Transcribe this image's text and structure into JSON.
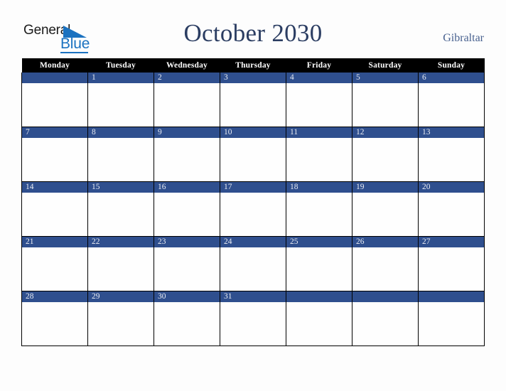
{
  "brand": {
    "name_part1": "General",
    "name_part2": "Blue",
    "accent_color": "#1b72c0",
    "triangle_icon": "triangle-icon"
  },
  "header": {
    "title": "October 2030",
    "country": "Gibraltar",
    "title_color": "#2b3d62",
    "country_color": "#48618f"
  },
  "calendar": {
    "month": "October",
    "year": "2030",
    "header_background": "#000000",
    "day_bar_color": "#2f4f8e",
    "weekday_headers": [
      "Monday",
      "Tuesday",
      "Wednesday",
      "Thursday",
      "Friday",
      "Saturday",
      "Sunday"
    ],
    "weeks": [
      [
        "",
        "1",
        "2",
        "3",
        "4",
        "5",
        "6"
      ],
      [
        "7",
        "8",
        "9",
        "10",
        "11",
        "12",
        "13"
      ],
      [
        "14",
        "15",
        "16",
        "17",
        "18",
        "19",
        "20"
      ],
      [
        "21",
        "22",
        "23",
        "24",
        "25",
        "26",
        "27"
      ],
      [
        "28",
        "29",
        "30",
        "31",
        "",
        "",
        ""
      ]
    ]
  }
}
